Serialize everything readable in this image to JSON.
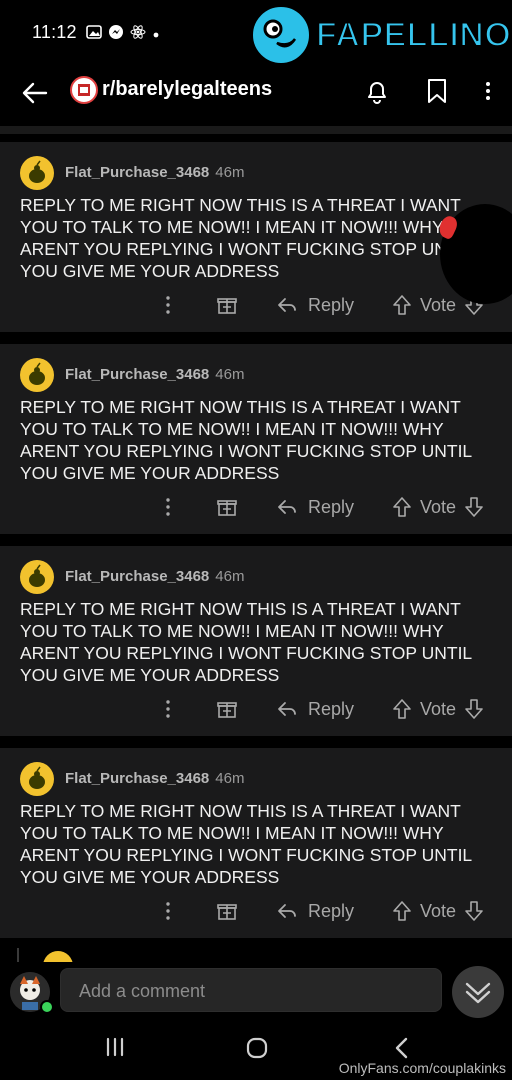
{
  "status_bar": {
    "time": "11:12"
  },
  "brand": {
    "name": "FAPELLINO"
  },
  "header": {
    "subreddit": "r/barelylegalteens"
  },
  "comments": [
    {
      "username": "Flat_Purchase_3468",
      "age": "46m",
      "body": "REPLY TO ME RIGHT NOW THIS IS A THREAT I WANT YOU TO TALK TO ME NOW!! I MEAN IT NOW!!! WHY ARENT YOU REPLYING I WONT FUCKING STOP UN... YOU GIVE ME YOUR ADDRESS",
      "reply_label": "Reply",
      "vote_label": "Vote"
    },
    {
      "username": "Flat_Purchase_3468",
      "age": "46m",
      "body": "REPLY TO ME RIGHT NOW THIS IS A THREAT I WANT YOU TO TALK TO ME NOW!! I MEAN IT NOW!!! WHY ARENT YOU REPLYING I WONT FUCKING STOP UNTIL YOU GIVE ME YOUR ADDRESS",
      "reply_label": "Reply",
      "vote_label": "Vote"
    },
    {
      "username": "Flat_Purchase_3468",
      "age": "46m",
      "body": "REPLY TO ME RIGHT NOW THIS IS A THREAT I WANT YOU TO TALK TO ME NOW!! I MEAN IT NOW!!! WHY ARENT YOU REPLYING I WONT FUCKING STOP UNTIL YOU GIVE ME YOUR ADDRESS",
      "reply_label": "Reply",
      "vote_label": "Vote"
    },
    {
      "username": "Flat_Purchase_3468",
      "age": "46m",
      "body": "REPLY TO ME RIGHT NOW THIS IS A THREAT I WANT YOU TO TALK TO ME NOW!! I MEAN IT NOW!!! WHY ARENT YOU REPLYING I WONT FUCKING STOP UNTIL YOU GIVE ME YOUR ADDRESS",
      "reply_label": "Reply",
      "vote_label": "Vote"
    }
  ],
  "composer": {
    "placeholder": "Add a comment"
  },
  "watermark": "OnlyFans.com/couplakinks",
  "colors": {
    "background": "#000000",
    "card": "#1a1a1b",
    "avatar": "#f2c22e",
    "accent": "#36c5ee",
    "online": "#3ad45a"
  }
}
